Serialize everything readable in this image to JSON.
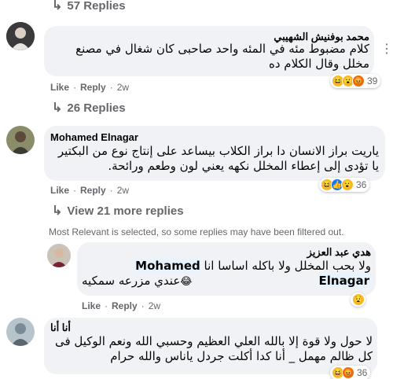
{
  "top_replies": {
    "label": "57 Replies"
  },
  "comment1": {
    "author": "محمد بوفنيش الشهيبي",
    "text": "كلام مضبوط مئه في المئه واحد صاحبى كان شغال في مصنع مخلل وقال الكلام ده",
    "like": "Like",
    "reply": "Reply",
    "time": "2w",
    "reaction_count": "39",
    "replies_label": "26 Replies"
  },
  "comment2": {
    "author": "Mohamed Elnagar",
    "text": "ياريت براز الانسان دا براز الكلاب بيساعد على إنتاج نوع من البكتير يا تؤدى إلى إعطاء المخلل نكهه يعني لون وطعم ورائحة.",
    "like": "Like",
    "reply": "Reply",
    "time": "2w",
    "reaction_count": "36",
    "replies_label": "View 21 more replies"
  },
  "filter_notice": "Most Relevant is selected, so some replies may have been filtered out.",
  "reply1": {
    "author": "هدي عبد العزيز",
    "mention": "Mohamed Elnagar",
    "text_line1": "ولا بحب المخلل ولا باكله اساسا انا",
    "text_line2": "عندي مزرعه سمكيه",
    "like": "Like",
    "reply": "Reply",
    "time": "2w"
  },
  "comment3": {
    "author": "أنا أنا",
    "text": "لا حول ولا قوة إلا بالله العلي العظيم وحسبي الله ونعم الوكيل فى كل ظالم مهمل _ أنا كدا أكلت جردل ياناس والله حرام",
    "reaction_count": "36"
  },
  "icons": {
    "reply_arrow": "reply-arrow-icon",
    "more": "more-dots-icon"
  }
}
